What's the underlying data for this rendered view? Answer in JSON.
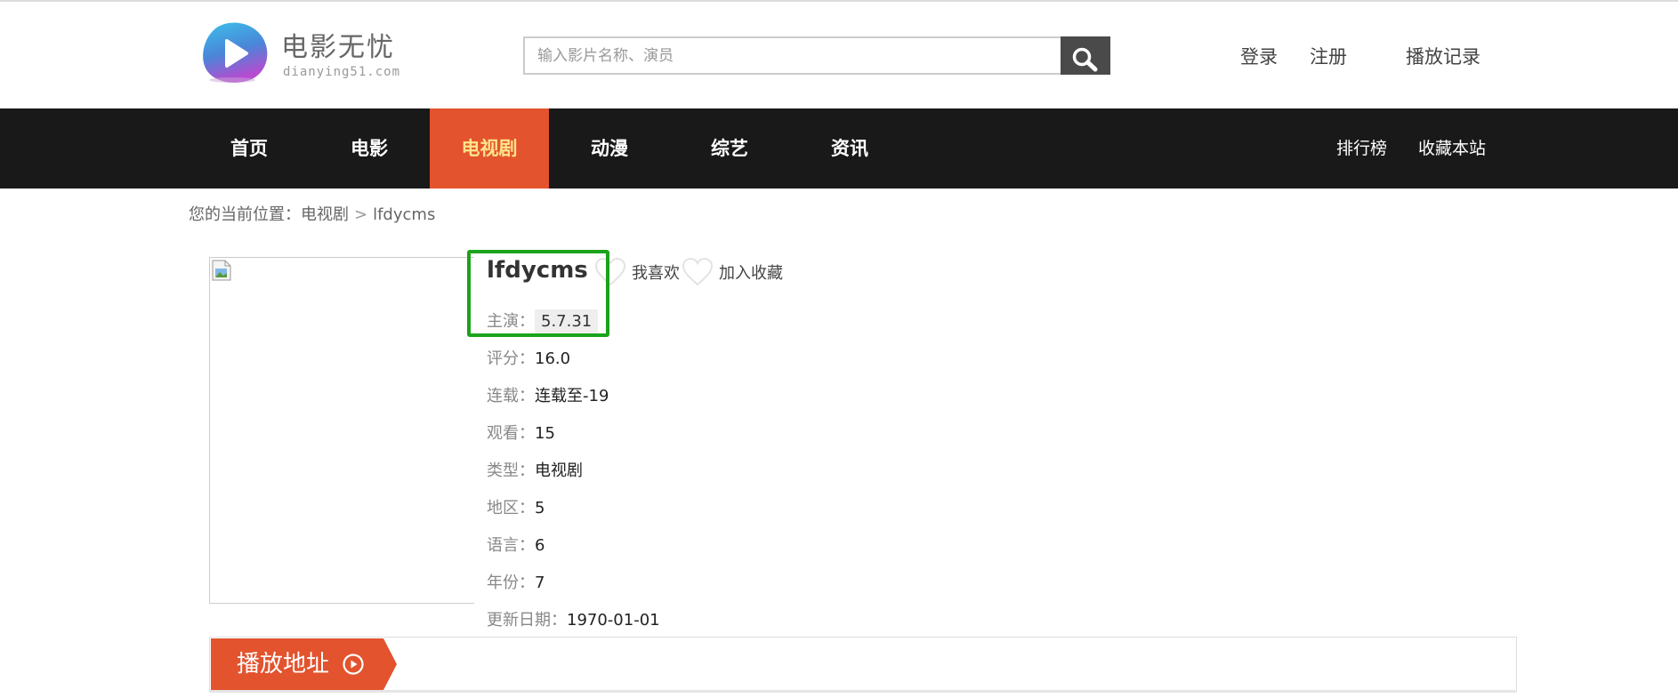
{
  "brand": {
    "name": "电影无忧",
    "domain": "dianying51.com",
    "logo_icon": "play-logo-icon",
    "colors": {
      "logo_top": "#3fb0e8",
      "logo_bottom": "#b24fd0"
    }
  },
  "search": {
    "placeholder": "输入影片名称、演员",
    "value": "",
    "button_icon": "search-icon"
  },
  "header_links": {
    "login": "登录",
    "register": "注册",
    "history": "播放记录"
  },
  "nav": {
    "items": [
      {
        "label": "首页",
        "active": false
      },
      {
        "label": "电影",
        "active": false
      },
      {
        "label": "电视剧",
        "active": true
      },
      {
        "label": "动漫",
        "active": false
      },
      {
        "label": "综艺",
        "active": false
      },
      {
        "label": "资讯",
        "active": false
      }
    ],
    "right": {
      "ranking": "排行榜",
      "bookmark": "收藏本站"
    },
    "colors": {
      "bar": "#191919",
      "active_bg": "#e2532e",
      "active_text": "#ffe38a"
    }
  },
  "breadcrumb": {
    "prefix": "您的当前位置：",
    "category": "电视剧",
    "separator": ">",
    "current": "lfdycms"
  },
  "detail": {
    "title": "lfdycms",
    "like_label": "我喜欢",
    "favorite_label": "加入收藏",
    "heart_icon": "heart-outline-icon",
    "fields": [
      {
        "label": "主演：",
        "value": "5.7.31"
      },
      {
        "label": "评分：",
        "value": "16.0"
      },
      {
        "label": "连载：",
        "value": "连载至-19"
      },
      {
        "label": "观看：",
        "value": "15"
      },
      {
        "label": "类型：",
        "value": "电视剧"
      },
      {
        "label": "地区：",
        "value": "5"
      },
      {
        "label": "语言：",
        "value": "6"
      },
      {
        "label": "年份：",
        "value": "7"
      },
      {
        "label": "更新日期：",
        "value": "1970-01-01"
      }
    ],
    "highlight_color": "#1aa31a"
  },
  "play": {
    "label": "播放地址",
    "icon": "play-circle-icon",
    "color": "#e2532e"
  }
}
